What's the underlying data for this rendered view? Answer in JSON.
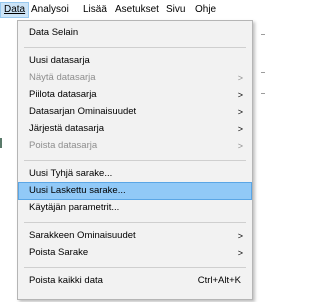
{
  "menubar": {
    "items": [
      {
        "label": "Data",
        "active": true
      },
      {
        "label": "Analysoi"
      },
      {
        "label": "Lisää"
      },
      {
        "label": "Asetukset"
      },
      {
        "label": "Sivu"
      },
      {
        "label": "Ohje"
      }
    ]
  },
  "data_menu": {
    "selain": "Data Selain",
    "uusi_datasarja": "Uusi datasarja",
    "nayta_datasarja": "Näytä datasarja",
    "piilota_datasarja": "Piilota datasarja",
    "ominaisuudet": "Datasarjan Ominaisuudet",
    "jarjesta": "Järjestä datasarja",
    "poista_datasarja": "Poista datasarja",
    "uusi_tyhja": "Uusi Tyhjä sarake...",
    "uusi_laskettu": "Uusi Laskettu sarake...",
    "kayttajan_parametrit": "Käytäjän parametrit...",
    "sarakkeen_ominaisuudet": "Sarakkeen Ominaisuudet",
    "poista_sarake": "Poista Sarake",
    "poista_kaikki": "Poista kaikki data",
    "poista_kaikki_shortcut": "Ctrl+Alt+K",
    "submenu_arrow": ">"
  }
}
